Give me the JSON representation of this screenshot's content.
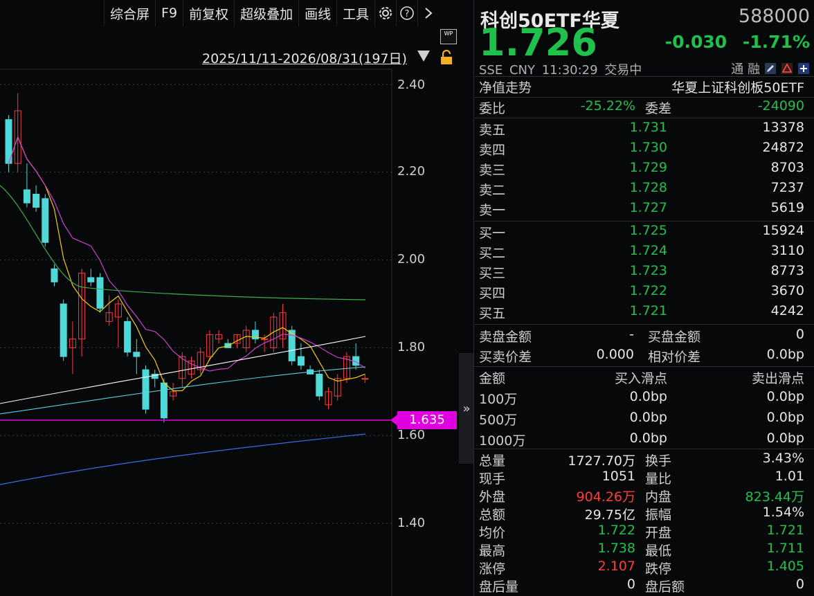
{
  "toolbar": {
    "items": [
      "综合屏",
      "F9",
      "前复权",
      "超级叠加",
      "画线",
      "工具"
    ],
    "settings_icon": "gear-icon",
    "help_icon": "question-icon",
    "next_icon": "chevron-right-icon"
  },
  "chart": {
    "range_label": "2025/11/11-2026/08/31(197日)",
    "wp_badge": "WP",
    "y_ticks": [
      "2.40",
      "2.20",
      "2.00",
      "1.80",
      "1.60",
      "1.40"
    ],
    "price_line_label": "1.635",
    "collapse_icon": "»",
    "colors": {
      "up": "#ff3b3b",
      "down": "#4fd8d8",
      "ma5": "#e0e0e0",
      "ma10": "#f5d000",
      "ma20": "#d040d0",
      "ma60": "#3bb04c",
      "ma120": "#ffffff",
      "ma250": "#3c6cf0",
      "level": "#e000e0"
    }
  },
  "chart_data": {
    "type": "candlestick",
    "ylim": [
      1.3,
      2.45
    ],
    "candles": [
      {
        "o": 2.32,
        "h": 2.33,
        "l": 2.2,
        "c": 2.22
      },
      {
        "o": 2.22,
        "h": 2.38,
        "l": 2.2,
        "c": 2.34
      },
      {
        "o": 2.16,
        "h": 2.22,
        "l": 2.12,
        "c": 2.13
      },
      {
        "o": 2.15,
        "h": 2.17,
        "l": 2.11,
        "c": 2.12
      },
      {
        "o": 2.14,
        "h": 2.15,
        "l": 2.03,
        "c": 2.04
      },
      {
        "o": 1.98,
        "h": 1.99,
        "l": 1.94,
        "c": 1.95
      },
      {
        "o": 1.9,
        "h": 1.91,
        "l": 1.77,
        "c": 1.78
      },
      {
        "o": 1.8,
        "h": 1.86,
        "l": 1.74,
        "c": 1.82
      },
      {
        "o": 1.82,
        "h": 1.98,
        "l": 1.78,
        "c": 1.97
      },
      {
        "o": 1.96,
        "h": 1.98,
        "l": 1.94,
        "c": 1.95
      },
      {
        "o": 1.96,
        "h": 1.97,
        "l": 1.88,
        "c": 1.89
      },
      {
        "o": 1.86,
        "h": 1.92,
        "l": 1.85,
        "c": 1.88
      },
      {
        "o": 1.87,
        "h": 1.91,
        "l": 1.8,
        "c": 1.9
      },
      {
        "o": 1.86,
        "h": 1.87,
        "l": 1.78,
        "c": 1.79
      },
      {
        "o": 1.79,
        "h": 1.82,
        "l": 1.74,
        "c": 1.78
      },
      {
        "o": 1.75,
        "h": 1.76,
        "l": 1.65,
        "c": 1.66
      },
      {
        "o": 1.74,
        "h": 1.75,
        "l": 1.71,
        "c": 1.73
      },
      {
        "o": 1.72,
        "h": 1.73,
        "l": 1.63,
        "c": 1.64
      },
      {
        "o": 1.69,
        "h": 1.72,
        "l": 1.68,
        "c": 1.7
      },
      {
        "o": 1.73,
        "h": 1.79,
        "l": 1.71,
        "c": 1.78
      },
      {
        "o": 1.74,
        "h": 1.78,
        "l": 1.73,
        "c": 1.77
      },
      {
        "o": 1.75,
        "h": 1.8,
        "l": 1.74,
        "c": 1.79
      },
      {
        "o": 1.78,
        "h": 1.84,
        "l": 1.77,
        "c": 1.83
      },
      {
        "o": 1.82,
        "h": 1.84,
        "l": 1.81,
        "c": 1.83
      },
      {
        "o": 1.81,
        "h": 1.82,
        "l": 1.8,
        "c": 1.8
      },
      {
        "o": 1.81,
        "h": 1.83,
        "l": 1.8,
        "c": 1.83
      },
      {
        "o": 1.8,
        "h": 1.85,
        "l": 1.79,
        "c": 1.84
      },
      {
        "o": 1.84,
        "h": 1.86,
        "l": 1.81,
        "c": 1.82
      },
      {
        "o": 1.82,
        "h": 1.83,
        "l": 1.79,
        "c": 1.82
      },
      {
        "o": 1.8,
        "h": 1.88,
        "l": 1.79,
        "c": 1.87
      },
      {
        "o": 1.82,
        "h": 1.9,
        "l": 1.8,
        "c": 1.88
      },
      {
        "o": 1.84,
        "h": 1.85,
        "l": 1.76,
        "c": 1.77
      },
      {
        "o": 1.78,
        "h": 1.81,
        "l": 1.75,
        "c": 1.76
      },
      {
        "o": 1.75,
        "h": 1.76,
        "l": 1.74,
        "c": 1.74
      },
      {
        "o": 1.74,
        "h": 1.75,
        "l": 1.68,
        "c": 1.69
      },
      {
        "o": 1.67,
        "h": 1.71,
        "l": 1.66,
        "c": 1.7
      },
      {
        "o": 1.69,
        "h": 1.74,
        "l": 1.68,
        "c": 1.73
      },
      {
        "o": 1.73,
        "h": 1.79,
        "l": 1.72,
        "c": 1.78
      },
      {
        "o": 1.78,
        "h": 1.81,
        "l": 1.75,
        "c": 1.76
      },
      {
        "o": 1.73,
        "h": 1.74,
        "l": 1.72,
        "c": 1.73
      }
    ]
  },
  "quote": {
    "name": "科创50ETF华夏",
    "code": "588000",
    "price": "1.726",
    "change": "-0.030",
    "change_pct": "-1.71%",
    "market": "SSE",
    "currency": "CNY",
    "time": "11:30:29",
    "status": "交易中",
    "tags": "通 融",
    "nav_label": "净值走势",
    "index_name": "华夏上证科创板50ETF"
  },
  "weibi": {
    "label1": "委比",
    "value1": "-25.22%",
    "label2": "委差",
    "value2": "-24090"
  },
  "asks": [
    {
      "label": "卖五",
      "price": "1.731",
      "vol": "13378"
    },
    {
      "label": "卖四",
      "price": "1.730",
      "vol": "24872"
    },
    {
      "label": "卖三",
      "price": "1.729",
      "vol": "8703"
    },
    {
      "label": "卖二",
      "price": "1.728",
      "vol": "7237"
    },
    {
      "label": "卖一",
      "price": "1.727",
      "vol": "5619"
    }
  ],
  "bids": [
    {
      "label": "买一",
      "price": "1.725",
      "vol": "15924"
    },
    {
      "label": "买二",
      "price": "1.724",
      "vol": "3110"
    },
    {
      "label": "买三",
      "price": "1.723",
      "vol": "8773"
    },
    {
      "label": "买四",
      "price": "1.722",
      "vol": "3670"
    },
    {
      "label": "买五",
      "price": "1.721",
      "vol": "4242"
    }
  ],
  "depth": [
    {
      "l1": "卖盘金额",
      "v1": "-",
      "l2": "买盘金额",
      "v2": "0"
    },
    {
      "l1": "买卖价差",
      "v1": "0.000",
      "l2": "相对价差",
      "v2": "0.0bp"
    }
  ],
  "slippage": {
    "headers": [
      "金额",
      "买入滑点",
      "卖出滑点"
    ],
    "rows": [
      {
        "amt": "100万",
        "buy": "0.0bp",
        "sell": "0.0bp"
      },
      {
        "amt": "500万",
        "buy": "0.0bp",
        "sell": "0.0bp"
      },
      {
        "amt": "1000万",
        "buy": "0.0bp",
        "sell": "0.0bp"
      }
    ]
  },
  "stats": [
    {
      "l1": "总量",
      "v1": "1727.70万",
      "l2": "换手",
      "v2": "3.43%"
    },
    {
      "l1": "现手",
      "v1": "1051",
      "l2": "量比",
      "v2": "1.01"
    },
    {
      "l1": "外盘",
      "v1": "904.26万",
      "l2": "内盘",
      "v2": "823.44万"
    },
    {
      "l1": "总额",
      "v1": "29.75亿",
      "l2": "振幅",
      "v2": "1.54%"
    },
    {
      "l1": "均价",
      "v1": "1.722",
      "l2": "开盘",
      "v2": "1.721"
    },
    {
      "l1": "最高",
      "v1": "1.738",
      "l2": "最低",
      "v2": "1.711"
    },
    {
      "l1": "涨停",
      "v1": "2.107",
      "l2": "跌停",
      "v2": "1.405"
    },
    {
      "l1": "盘后量",
      "v1": "0",
      "l2": "盘后额",
      "v2": "0"
    }
  ]
}
